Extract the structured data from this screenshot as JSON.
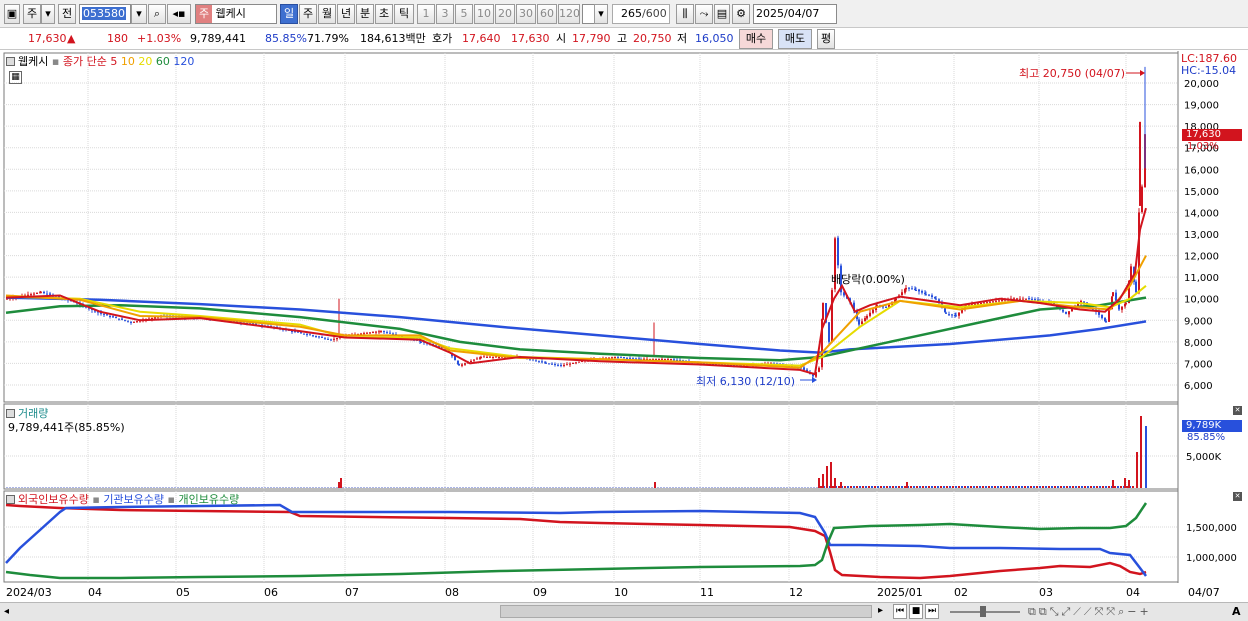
{
  "toolbar": {
    "market_btn": "주",
    "prev_btn": "전",
    "code": "053580",
    "stock_type": "주",
    "stock_name": "웹케시",
    "periods": [
      "일",
      "주",
      "월",
      "년",
      "분",
      "초",
      "틱"
    ],
    "selected_period": "일",
    "intervals": [
      "1",
      "3",
      "5",
      "10",
      "20",
      "30",
      "60",
      "120"
    ],
    "count": "265",
    "count_total": "/600",
    "date": "2025/04/07"
  },
  "quote": {
    "price": "17,630",
    "direction": "▲",
    "change": "180",
    "change_pct": "+1.03%",
    "volume": "9,789,441",
    "vol_ratio": "85.85%",
    "turnover": "71.79%",
    "amount": "184,613백만",
    "bid_label": "호가",
    "ask_price": "17,640",
    "bid_price": "17,630",
    "open_label": "시",
    "open": "17,790",
    "high_label": "고",
    "high": "20,750",
    "low_label": "저",
    "low": "16,050",
    "buy_btn": "매수",
    "sell_btn": "매도",
    "eval_btn": "평"
  },
  "price_pane": {
    "legend_name": "웹케시",
    "legend_series": "종가 단순",
    "ma": [
      {
        "label": "5",
        "color": "#d2141e"
      },
      {
        "label": "10",
        "color": "#f0a000"
      },
      {
        "label": "20",
        "color": "#e6dc00"
      },
      {
        "label": "60",
        "color": "#1e8c3c"
      },
      {
        "label": "120",
        "color": "#2850dc"
      }
    ],
    "lc": "LC:187.60",
    "hc": "HC:-15.04",
    "y_ticks": [
      "20,000",
      "19,000",
      "18,000",
      "17,000",
      "16,000",
      "15,000",
      "14,000",
      "13,000",
      "12,000",
      "11,000",
      "10,000",
      "9,000",
      "8,000",
      "7,000",
      "6,000"
    ],
    "current_price_tag": "17,630",
    "current_pct_tag": "1.03%",
    "high_annot": "최고 20,750 (04/07)",
    "low_annot": "최저 6,130 (12/10)",
    "div_annot": "배당락(0.00%)"
  },
  "volume_pane": {
    "title": "거래량",
    "value": "9,789,441주(85.85%)",
    "y_ticks": [
      "5,000K"
    ],
    "tag_value": "9,789K",
    "tag_pct": "85.85%"
  },
  "holder_pane": {
    "series": [
      {
        "label": "외국인보유수량",
        "color": "#d2141e"
      },
      {
        "label": "기관보유수량",
        "color": "#2850dc"
      },
      {
        "label": "개인보유수량",
        "color": "#1e8c3c"
      }
    ],
    "y_ticks": [
      "1,500,000",
      "1,000,000"
    ]
  },
  "x_labels": [
    {
      "label": "2024/03"
    },
    {
      "label": "04"
    },
    {
      "label": "05"
    },
    {
      "label": "06"
    },
    {
      "label": "07"
    },
    {
      "label": "08"
    },
    {
      "label": "09"
    },
    {
      "label": "10"
    },
    {
      "label": "11"
    },
    {
      "label": "12"
    },
    {
      "label": "2025/01"
    },
    {
      "label": "02"
    },
    {
      "label": "03"
    },
    {
      "label": "04"
    }
  ],
  "x_axis_right": "04/07",
  "chart_data": {
    "type": "line",
    "title": "웹케시",
    "y_range": [
      6000,
      20750
    ],
    "series": [
      {
        "name": "종가",
        "points_month": [
          "2024/03",
          "2024/04",
          "2024/05",
          "2024/06",
          "2024/07",
          "2024/08",
          "2024/09",
          "2024/10",
          "2024/11",
          "2024/12",
          "2025/01",
          "2025/02",
          "2025/03",
          "2025/04"
        ],
        "values": [
          10100,
          9400,
          9100,
          8900,
          8200,
          7300,
          7200,
          7300,
          7000,
          10300,
          9800,
          9800,
          9700,
          17630
        ]
      }
    ],
    "high": {
      "value": 20750,
      "date": "04/07"
    },
    "low": {
      "value": 6130,
      "date": "12/10"
    }
  }
}
